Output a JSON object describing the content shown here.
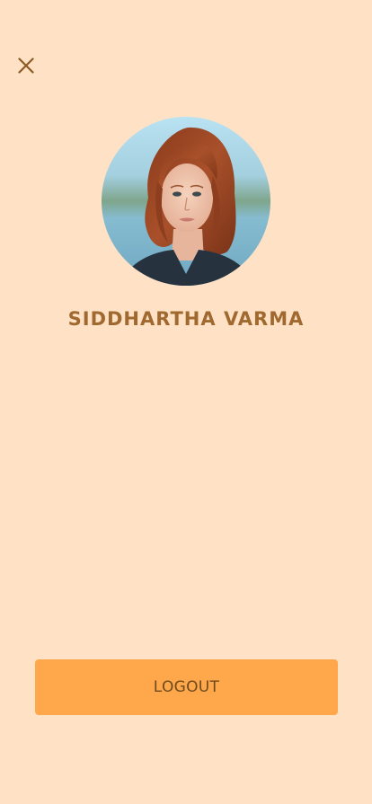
{
  "profile": {
    "close_icon": "close-icon",
    "avatar_alt": "",
    "name": "SIDDHARTHA VARMA"
  },
  "actions": {
    "logout_label": "LOGOUT"
  },
  "colors": {
    "background": "#FFE2C6",
    "name_text": "#A0692F",
    "icon": "#8A5A22",
    "button_bg": "#FFA84B",
    "button_text": "#6E4A1E"
  }
}
